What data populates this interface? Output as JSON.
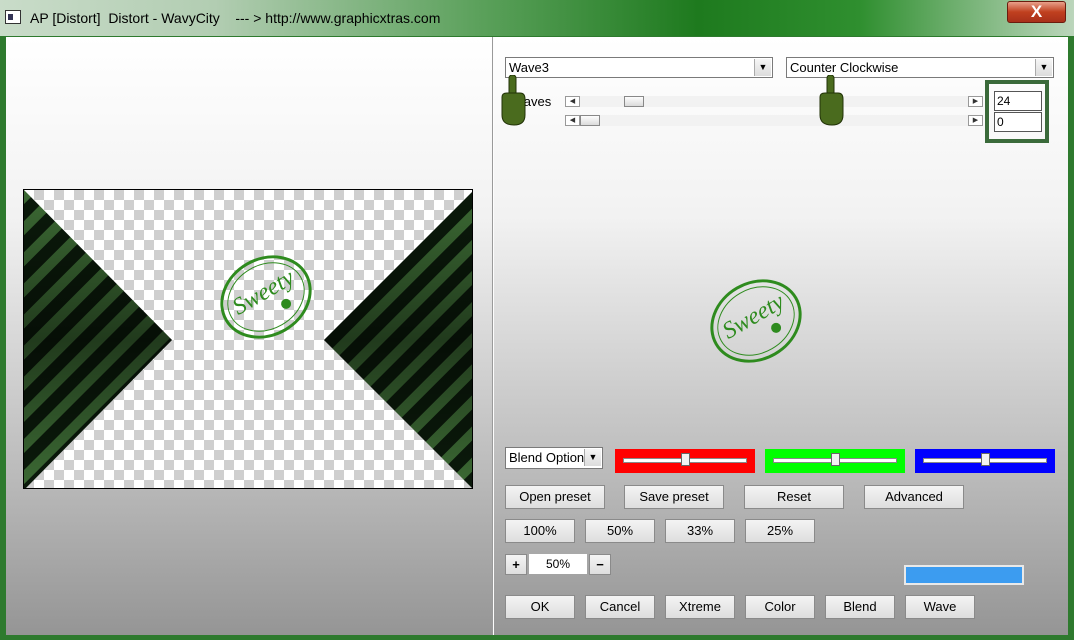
{
  "window": {
    "title": "AP [Distort]  Distort - WavyCity    --- > http://www.graphicxtras.com",
    "close_label": "X"
  },
  "controls": {
    "mode_select": "Wave3",
    "direction_select": "Counter Clockwise",
    "waves_label": "Waves",
    "waves_value": "24",
    "slider2_value": "0",
    "slider1_position": 0.12,
    "slider2_position": 0.0
  },
  "preview": {
    "watermark_text": "Sweety"
  },
  "blend": {
    "options_label": "Blend Option",
    "red_slider": 0.5,
    "green_slider": 0.5,
    "blue_slider": 0.5,
    "colors": {
      "red": "#ff0000",
      "green": "#00ff00",
      "blue": "#0000ff"
    }
  },
  "buttons": {
    "open_preset": "Open preset",
    "save_preset": "Save preset",
    "reset": "Reset",
    "advanced": "Advanced",
    "zoom100": "100%",
    "zoom50": "50%",
    "zoom33": "33%",
    "zoom25": "25%",
    "plus": "+",
    "minus": "−",
    "zoom_value": "50%",
    "ok": "OK",
    "cancel": "Cancel",
    "xtreme": "Xtreme",
    "color": "Color",
    "blend": "Blend",
    "wave": "Wave"
  },
  "accent_color": "#3c9cf0",
  "stripe_colors": [
    "#3c6a34",
    "#0b1a0b"
  ]
}
